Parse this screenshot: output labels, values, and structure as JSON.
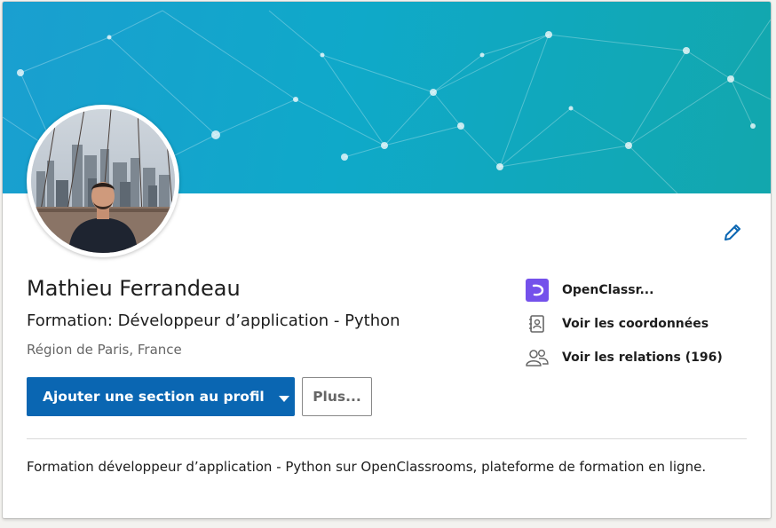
{
  "profile": {
    "name": "Mathieu Ferrandeau",
    "headline": "Formation: Développeur d’application - Python",
    "location": "Région de Paris, France",
    "summary": "Formation développeur d’application - Python sur OpenClassrooms, plateforme de formation en ligne."
  },
  "actions": {
    "add_section_label": "Ajouter une section au profil",
    "more_label": "Plus..."
  },
  "sidebar": {
    "items": [
      {
        "label": "OpenClassr...",
        "icon": "openclassrooms-logo-icon"
      },
      {
        "label": "Voir les coordonnées",
        "icon": "address-book-icon"
      },
      {
        "label": "Voir les relations (196)",
        "icon": "people-icon"
      }
    ]
  },
  "colors": {
    "primary_button": "#0a66b2",
    "banner_start": "#1a9fd0",
    "banner_end": "#12a7ad",
    "openclassrooms_brand": "#7451eb",
    "edit_icon": "#0a66b2"
  }
}
